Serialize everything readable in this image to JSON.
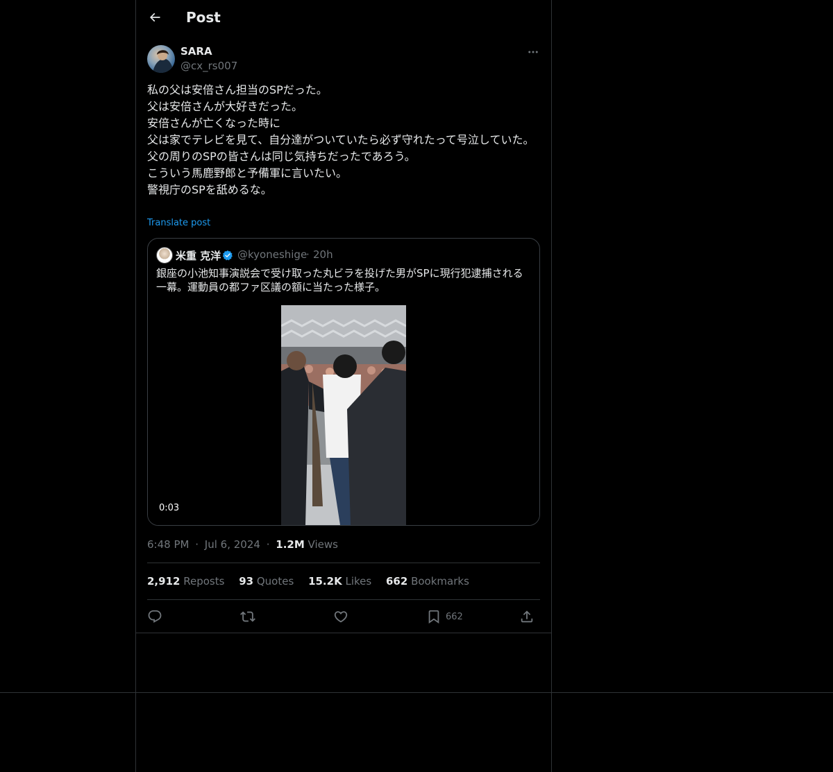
{
  "header": {
    "back_icon": "arrow-left-icon",
    "title": "Post"
  },
  "author": {
    "display_name": "SARA",
    "handle": "@cx_rs007",
    "more_icon": "more-horizontal-icon"
  },
  "post": {
    "lines": [
      "私の父は安倍さん担当のSPだった。",
      "父は安倍さんが大好きだった。",
      "安倍さんが亡くなった時に",
      "父は家でテレビを見て、自分達がついていたら必ず守れたって号泣していた。",
      "父の周りのSPの皆さんは同じ気持ちだったであろう。",
      "こういう馬鹿野郎と予備軍に言いたい。",
      "警視庁のSPを舐めるな。"
    ],
    "translate_label": "Translate post"
  },
  "quote": {
    "display_name": "米重 克洋",
    "verified_icon": "verified-badge-icon",
    "handle": "@kyoneshige",
    "dot": "·",
    "time": "20h",
    "text": "銀座の小池知事演説会で受け取った丸ビラを投げた男がSPに現行犯逮捕される一幕。運動員の都ファ区議の額に当たった様子。",
    "video_duration": "0:03"
  },
  "meta": {
    "time": "6:48 PM",
    "sep1": "·",
    "date": "Jul 6, 2024",
    "sep2": "·",
    "views_count": "1.2M",
    "views_label": "Views"
  },
  "stats": {
    "reposts_count": "2,912",
    "reposts_label": "Reposts",
    "quotes_count": "93",
    "quotes_label": "Quotes",
    "likes_count": "15.2K",
    "likes_label": "Likes",
    "bookmarks_count": "662",
    "bookmarks_label": "Bookmarks"
  },
  "actions": {
    "reply_icon": "reply-icon",
    "repost_icon": "repost-icon",
    "like_icon": "like-icon",
    "bookmark_icon": "bookmark-icon",
    "bookmark_count": "662",
    "share_icon": "share-icon"
  },
  "colors": {
    "background": "#000000",
    "text": "#e7e9ea",
    "muted": "#71767b",
    "accent": "#1d9bf0",
    "border": "#2f3336"
  }
}
